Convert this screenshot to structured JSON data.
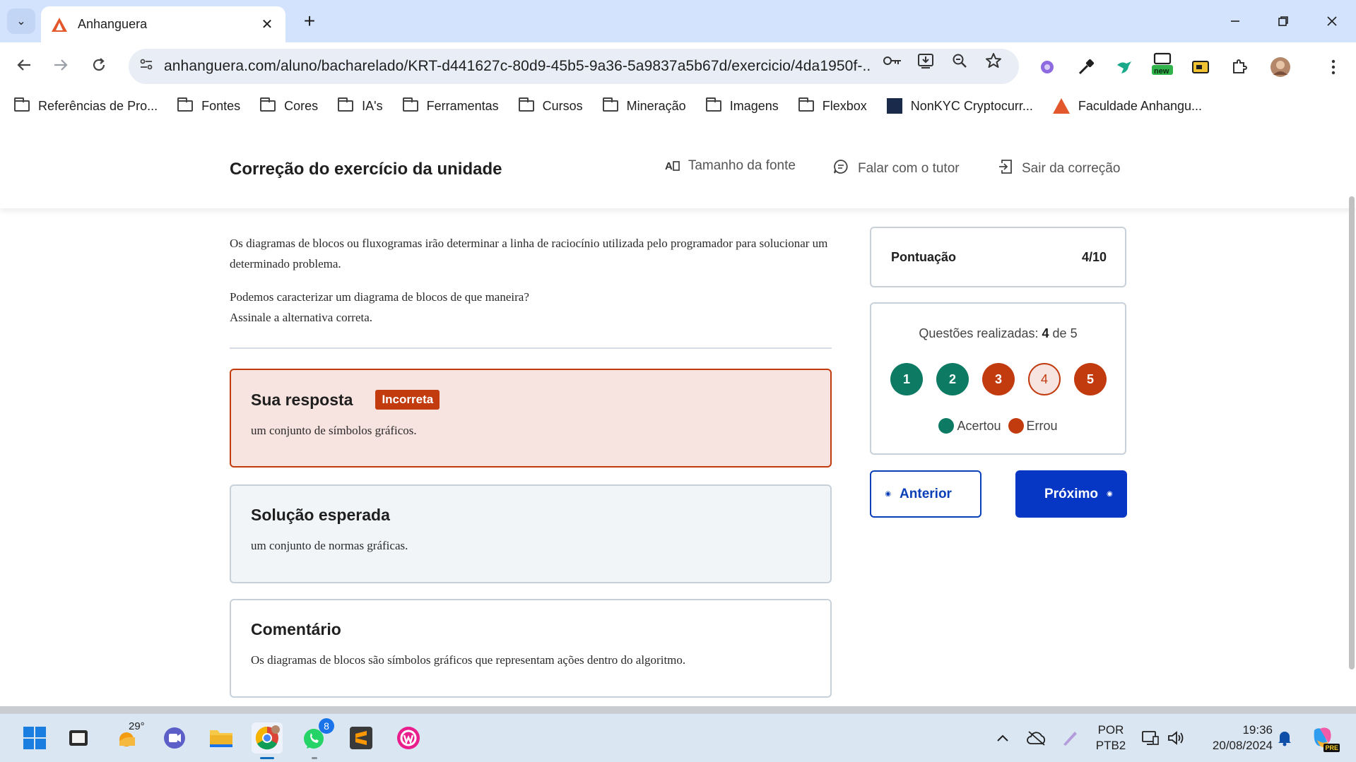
{
  "browser": {
    "tab_title": "Anhanguera",
    "tab_close": "✕",
    "new_tab": "+",
    "url": "anhanguera.com/aluno/bacharelado/KRT-d441627c-80d9-45b5-9a36-5a9837a5b67d/exercicio/4da1950f-...",
    "ext_badge": "new",
    "bookmarks": [
      {
        "type": "folder",
        "label": "Referências de Pro..."
      },
      {
        "type": "folder",
        "label": "Fontes"
      },
      {
        "type": "folder",
        "label": "Cores"
      },
      {
        "type": "folder",
        "label": "IA's"
      },
      {
        "type": "folder",
        "label": "Ferramentas"
      },
      {
        "type": "folder",
        "label": "Cursos"
      },
      {
        "type": "folder",
        "label": "Mineração"
      },
      {
        "type": "folder",
        "label": "Imagens"
      },
      {
        "type": "folder",
        "label": "Flexbox"
      },
      {
        "type": "site",
        "label": "NonKYC Cryptocurr..."
      },
      {
        "type": "site",
        "label": "Faculdade Anhangu..."
      }
    ]
  },
  "header": {
    "title": "Correção do exercício da unidade",
    "font_size_label": "Tamanho da fonte",
    "font_size_icon": "A",
    "tutor_label": "Falar com o tutor",
    "exit_label": "Sair da correção"
  },
  "question": {
    "paragraph1": "Os diagramas de blocos ou fluxogramas irão determinar a linha de raciocínio utilizada pelo programador para solucionar um determinado problema.",
    "paragraph2_line1": "Podemos caracterizar um diagrama de blocos de que maneira?",
    "paragraph2_line2": "Assinale a alternativa correta."
  },
  "answer": {
    "title": "Sua resposta",
    "badge": "Incorreta",
    "text": "um conjunto de símbolos gráficos."
  },
  "expected": {
    "title": "Solução esperada",
    "text": "um conjunto de normas gráficas."
  },
  "comment": {
    "title": "Comentário",
    "text": "Os diagramas de blocos são símbolos gráficos que representam ações dentro do algoritmo."
  },
  "score": {
    "label": "Pontuação",
    "value": "4/10"
  },
  "progress": {
    "prefix": "Questões realizadas:",
    "done": "4",
    "of_word": "de",
    "total": "5",
    "questions": [
      {
        "number": "1",
        "status": "correct"
      },
      {
        "number": "2",
        "status": "correct"
      },
      {
        "number": "3",
        "status": "wrong"
      },
      {
        "number": "4",
        "status": "current"
      },
      {
        "number": "5",
        "status": "wrong"
      }
    ],
    "legend_correct": "Acertou",
    "legend_wrong": "Errou"
  },
  "nav": {
    "prev_label": "Anterior",
    "next_label": "Próximo"
  },
  "taskbar": {
    "weather_temp": "29°",
    "whatsapp_badge": "8",
    "language_line1": "POR",
    "language_line2": "PTB2",
    "time": "19:36",
    "date": "20/08/2024",
    "copilot_badge": "PRE"
  },
  "colors": {
    "correct": "#0d7a63",
    "wrong": "#c23b0f",
    "primary": "#0536c4"
  }
}
